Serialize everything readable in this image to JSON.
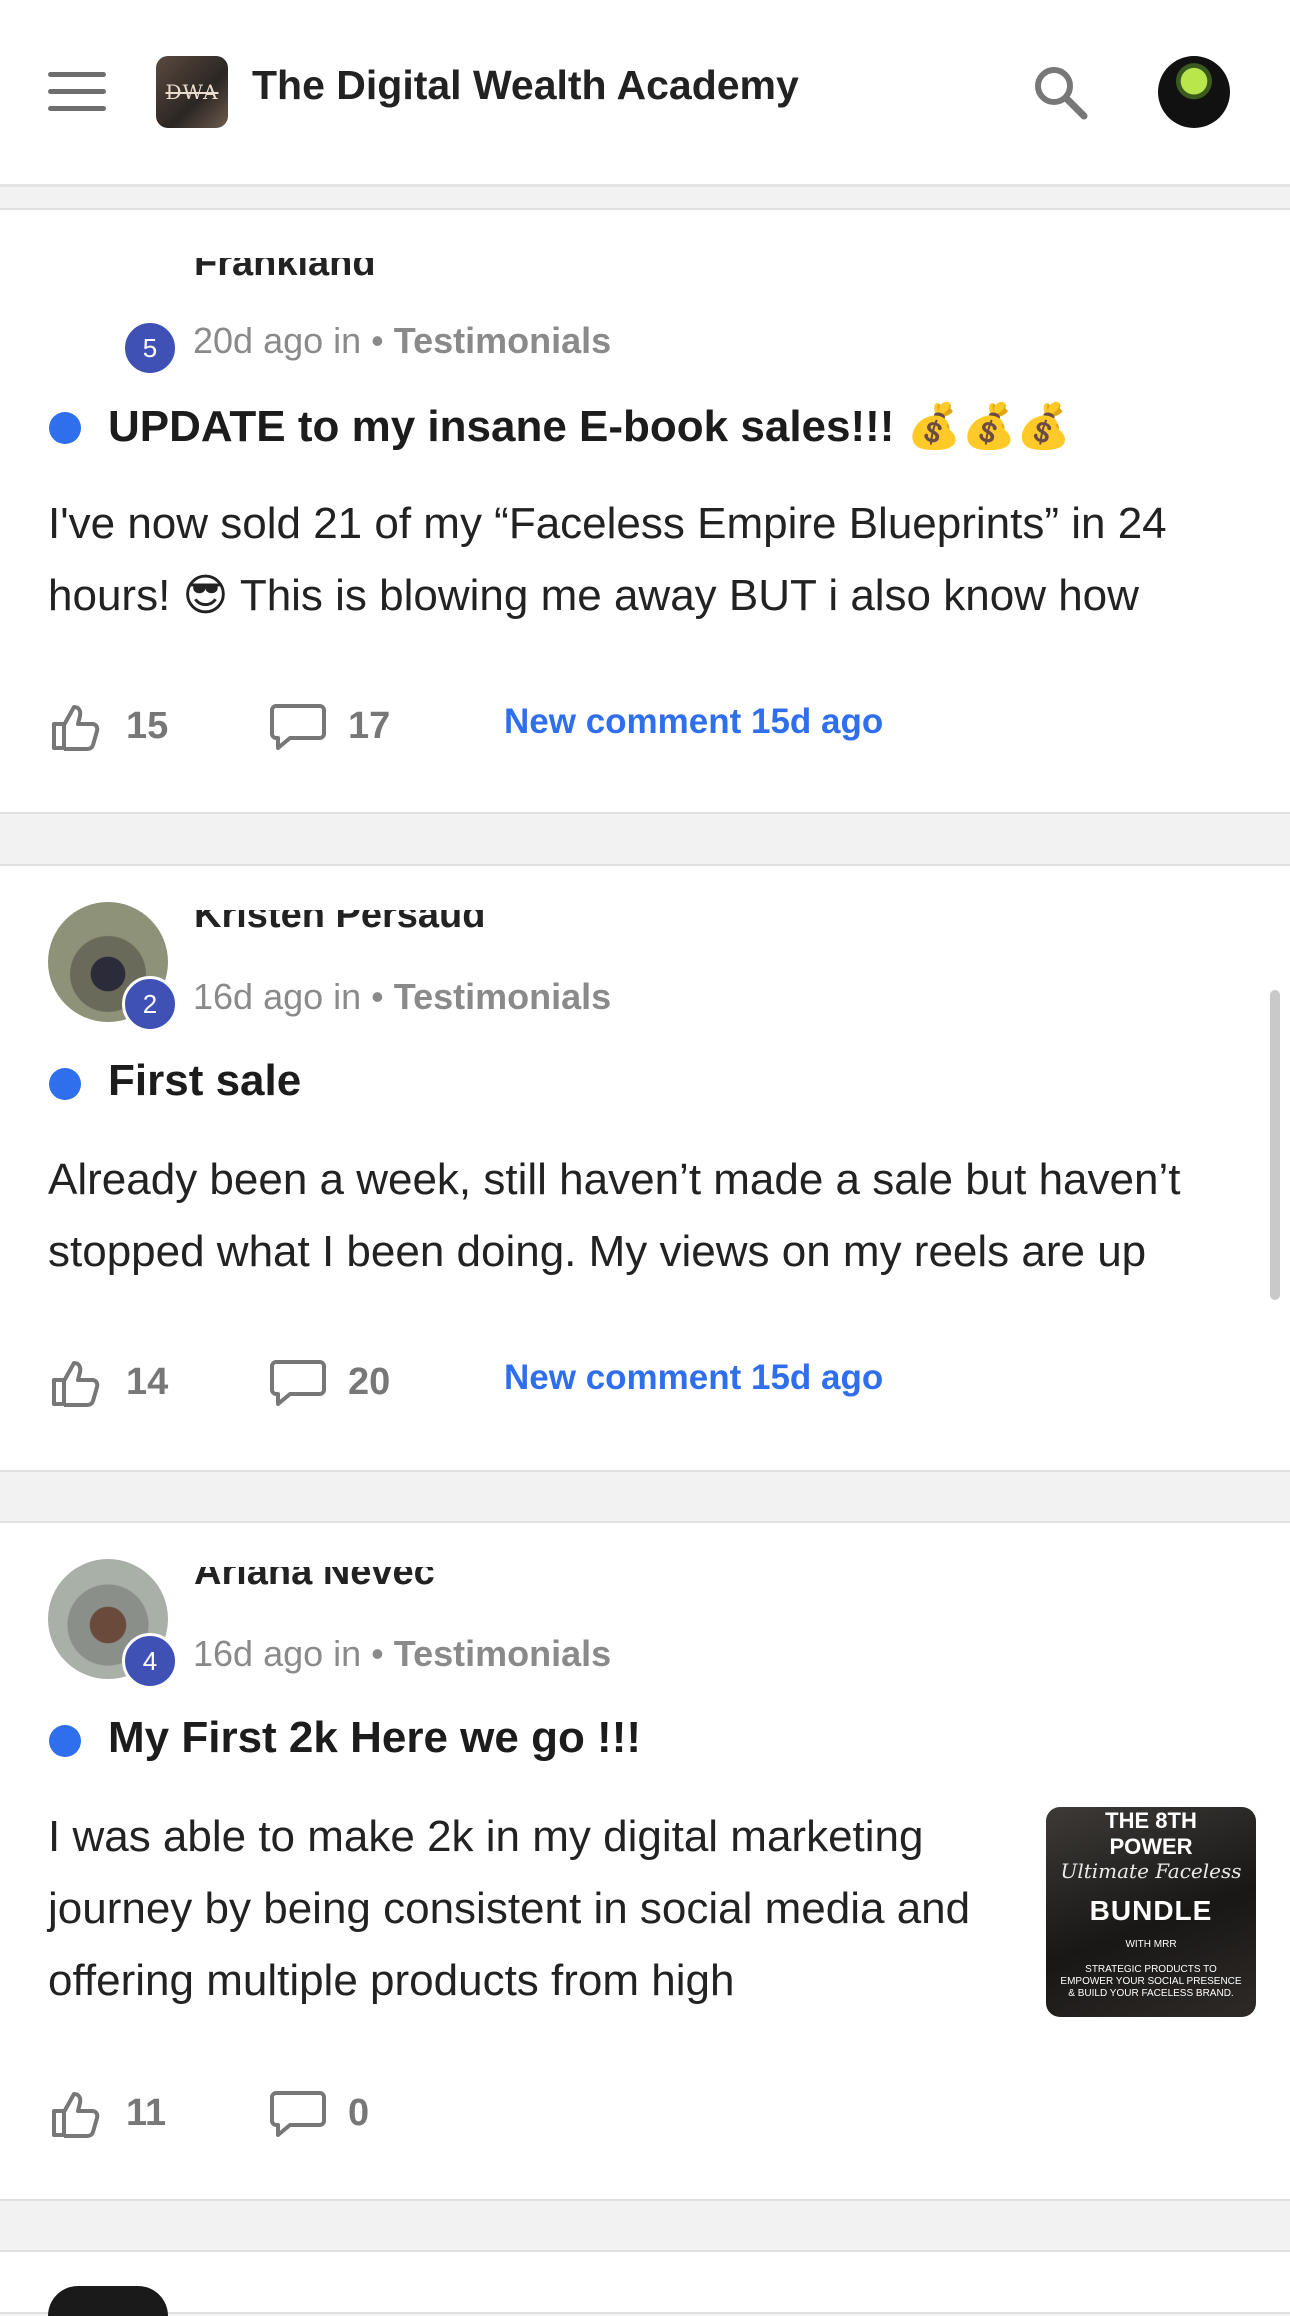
{
  "header": {
    "title": "The Digital Wealth Academy",
    "logo_text": "DWA",
    "menu_icon": "hamburger-menu-icon",
    "search_icon": "search-icon"
  },
  "colors": {
    "accent": "#2f6fed",
    "badge": "#3f51b5",
    "muted": "#8a8a8a"
  },
  "posts": [
    {
      "author": "Frankland",
      "level": "5",
      "meta_time": "20d ago in • ",
      "category": "Testimonials",
      "title": "UPDATE to my insane E-book sales!!! 💰💰💰",
      "body": "I've now sold 21 of my “Faceless Empire Blueprints” in 24 hours! 😎 This is blowing me away BUT i also know how",
      "likes": "15",
      "comments": "17",
      "new_comment": "New comment 15d ago"
    },
    {
      "author": "Kristen Persaud",
      "level": "2",
      "meta_time": "16d ago in • ",
      "category": "Testimonials",
      "title": "First sale",
      "body": "Already been a week, still haven’t made a sale but haven’t stopped what I been doing. My views on my reels are up",
      "likes": "14",
      "comments": "20",
      "new_comment": "New comment 15d ago"
    },
    {
      "author": "Ariana Nevec",
      "level": "4",
      "meta_time": "16d ago in • ",
      "category": "Testimonials",
      "title": "My First 2k Here we go !!!",
      "body": "I was able to make 2k in my digital marketing journey by being consistent in social media and offering multiple products from high",
      "likes": "11",
      "comments": "0",
      "thumbnail": {
        "line1": "THE 8TH",
        "line2": "POWER",
        "line3": "Ultimate Faceless",
        "line4": "BUNDLE",
        "line5": "WITH MRR",
        "line6": "STRATEGIC PRODUCTS TO EMPOWER YOUR SOCIAL PRESENCE & BUILD YOUR FACELESS BRAND."
      }
    }
  ]
}
